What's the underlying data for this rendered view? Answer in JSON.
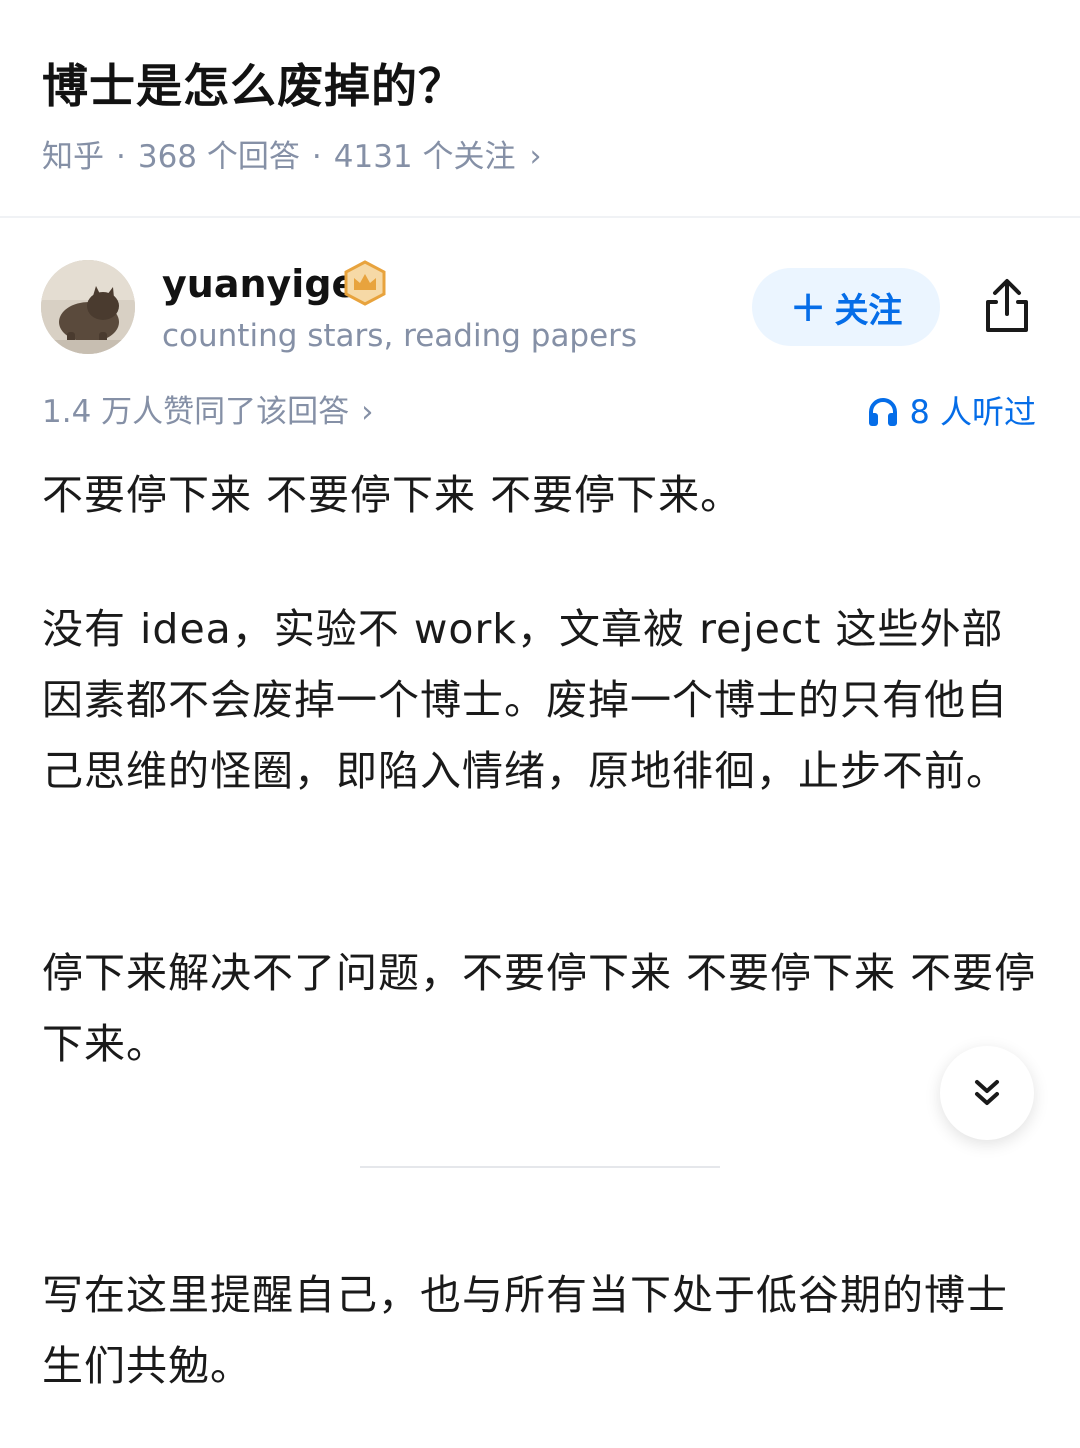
{
  "question": {
    "title": "博士是怎么废掉的？",
    "source": "知乎",
    "answers": "368 个回答",
    "followers": "4131 个关注",
    "chevron": "›"
  },
  "author": {
    "name": "yuanyige",
    "bio": "counting stars, reading papers",
    "avatar_icon": "cat-avatar",
    "badge_icon": "crown-badge-icon",
    "follow_plus": "+",
    "follow_label": "关注"
  },
  "answer": {
    "stats": "1.4 万人赞同了该回答",
    "stats_chevron": "›",
    "listen_label": "8 人听过",
    "paragraphs": [
      "不要停下来 不要停下来 不要停下来。",
      "没有 idea，实验不 work，文章被 reject 这些外部因素都不会废掉一个博士。废掉一个博士的只有他自己思维的怪圈，即陷入情绪，原地徘徊，止步不前。",
      "停下来解决不了问题，不要停下来 不要停下来 不要停下来。",
      "写在这里提醒自己，也与所有当下处于低谷期的博士生们共勉。"
    ]
  },
  "colors": {
    "accent": "#056de8",
    "muted": "#8590a6",
    "follow_bg": "#ebf5ff",
    "badge": "#e8a33d"
  }
}
